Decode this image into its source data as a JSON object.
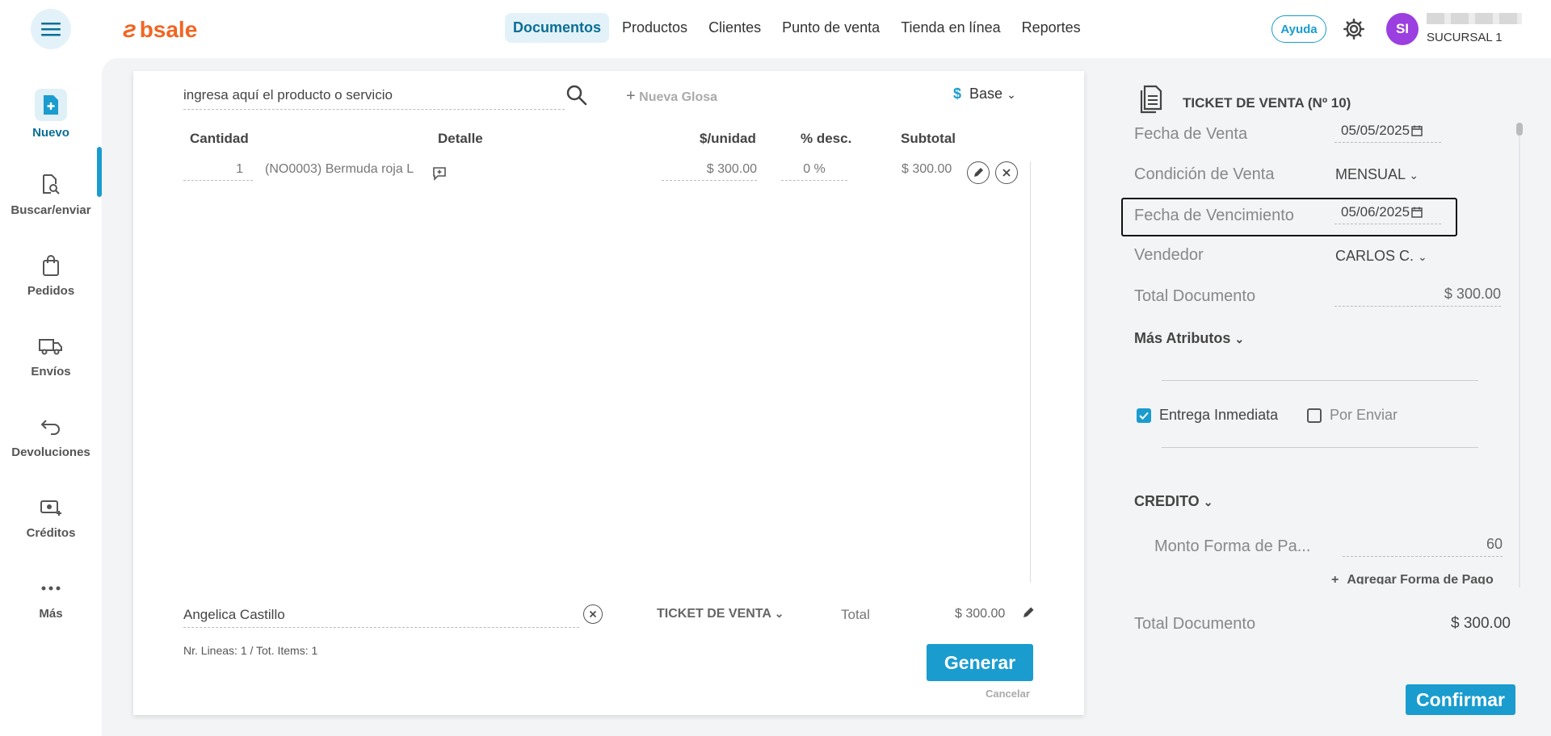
{
  "app": {
    "logo_text": "bsale"
  },
  "nav": {
    "items": [
      "Documentos",
      "Productos",
      "Clientes",
      "Punto de venta",
      "Tienda en línea",
      "Reportes"
    ],
    "active": "Documentos"
  },
  "header": {
    "help_label": "Ayuda",
    "avatar_initials": "SI",
    "branch": "SUCURSAL 1"
  },
  "sidebar": {
    "items": [
      {
        "label": "Nuevo",
        "icon": "new-document-icon"
      },
      {
        "label": "Buscar/enviar",
        "icon": "search-document-icon"
      },
      {
        "label": "Pedidos",
        "icon": "bag-icon"
      },
      {
        "label": "Envíos",
        "icon": "truck-icon"
      },
      {
        "label": "Devoluciones",
        "icon": "return-icon"
      },
      {
        "label": "Créditos",
        "icon": "money-icon"
      },
      {
        "label": "Más",
        "icon": "more-icon"
      }
    ]
  },
  "editor": {
    "search_placeholder": "ingresa aquí el producto o servicio",
    "new_glosa": "Nueva Glosa",
    "price_list": "Base",
    "currency_symbol": "$",
    "columns": [
      "Cantidad",
      "Detalle",
      "$/unidad",
      "% desc.",
      "Subtotal"
    ],
    "rows": [
      {
        "qty": "1",
        "detail": "(NO0003) Bermuda roja L",
        "unit_price": "$ 300.00",
        "discount": "0 %",
        "subtotal": "$ 300.00"
      }
    ],
    "client": "Angelica Castillo",
    "doc_type": "TICKET DE VENTA",
    "total_label": "Total",
    "total_value": "$ 300.00",
    "lines_summary": "Nr. Lineas: 1 / Tot. Items: 1",
    "generate_label": "Generar",
    "cancel_label": "Cancelar"
  },
  "panel": {
    "title": "TICKET DE VENTA (Nº 10)",
    "fecha_venta_label": "Fecha de Venta",
    "fecha_venta": "05/05/2025",
    "condicion_label": "Condición de Venta",
    "condicion": "MENSUAL",
    "vencimiento_label": "Fecha de Vencimiento",
    "vencimiento": "05/06/2025",
    "vendedor_label": "Vendedor",
    "vendedor": "CARLOS C.",
    "total_doc_label": "Total Documento",
    "total_doc": "$ 300.00",
    "mas_atributos": "Más Atributos",
    "entrega_inmediata": "Entrega Inmediata",
    "entrega_inmediata_checked": true,
    "por_enviar": "Por Enviar",
    "por_enviar_checked": false,
    "payment_method": "CREDITO",
    "monto_label": "Monto Forma de Pa...",
    "monto_value": "60",
    "add_payment": "Agregar Forma de Pago",
    "footer_total_label": "Total Documento",
    "footer_total": "$ 300.00",
    "confirm_label": "Confirmar"
  },
  "colors": {
    "accent": "#1a9ccf",
    "brand": "#f26522",
    "avatar": "#9b3fe0"
  }
}
